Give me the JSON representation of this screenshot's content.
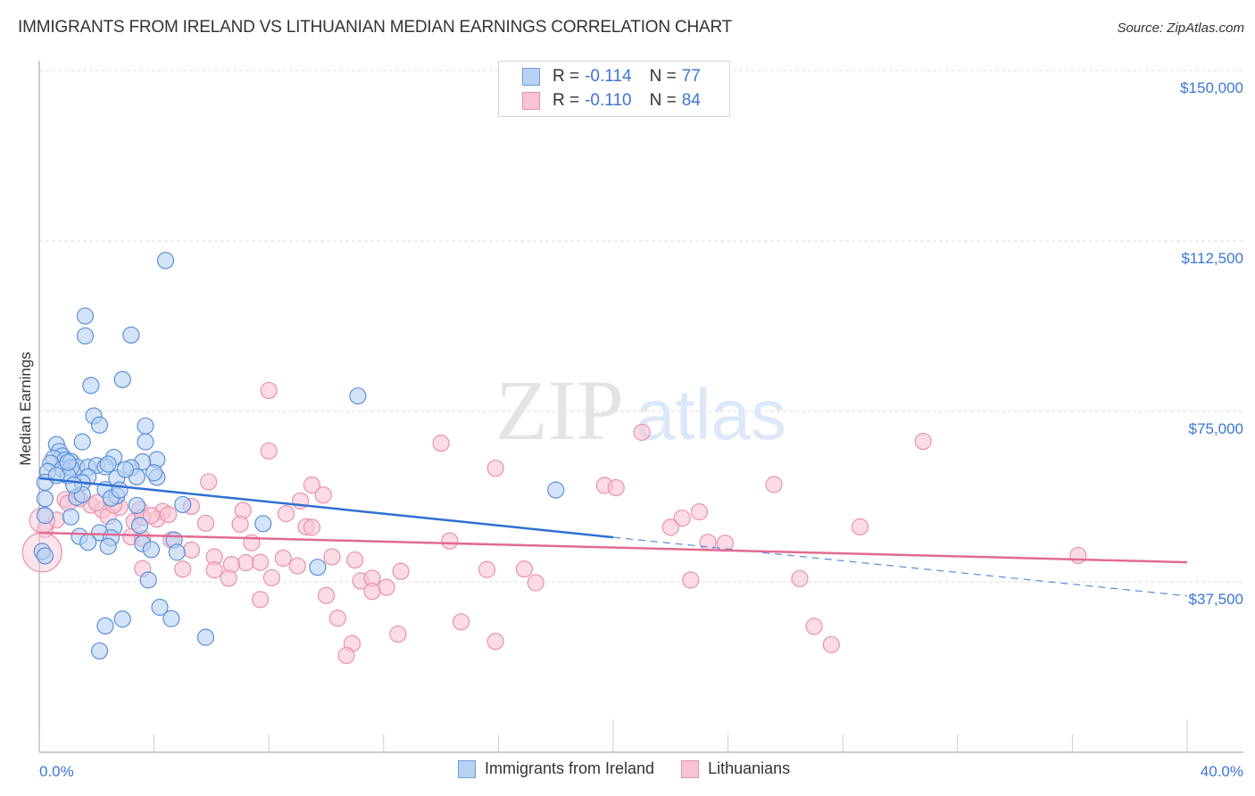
{
  "header": {
    "title": "IMMIGRANTS FROM IRELAND VS LITHUANIAN MEDIAN EARNINGS CORRELATION CHART",
    "source": "Source: ZipAtlas.com"
  },
  "watermark": {
    "zip": "ZIP",
    "atlas": "atlas"
  },
  "legend": {
    "rows": [
      {
        "r_label": "R =",
        "r_value": "-0.114",
        "n_label": "N =",
        "n_value": "77"
      },
      {
        "r_label": "R =",
        "r_value": "-0.110",
        "n_label": "N =",
        "n_value": "84"
      }
    ]
  },
  "bottom_legend": [
    "Immigrants from Ireland",
    "Lithuanians"
  ],
  "colors": {
    "blue_fill": "#b8d2f3",
    "blue_stroke": "#5b8fd8",
    "blue_line": "#2f6fd1",
    "pink_fill": "#f8c4d4",
    "pink_stroke": "#e891ac",
    "pink_line": "#e26a91",
    "tick_text": "#3a76d4"
  },
  "chart_data": {
    "type": "scatter",
    "title": "IMMIGRANTS FROM IRELAND VS LITHUANIAN MEDIAN EARNINGS CORRELATION CHART",
    "xlabel": "",
    "ylabel": "Median Earnings",
    "xlim": [
      0,
      40
    ],
    "ylim": [
      0,
      155000
    ],
    "x_tick_labels": [
      "0.0%",
      "40.0%"
    ],
    "y_ticks": [
      37500,
      75000,
      112500,
      150000
    ],
    "y_tick_labels": [
      "$37,500",
      "$75,000",
      "$112,500",
      "$150,000"
    ],
    "grid": true,
    "legend_position": "top-center",
    "series": [
      {
        "name": "Immigrants from Ireland",
        "R": -0.114,
        "N": 77,
        "trend": {
          "x": [
            0,
            20,
            40
          ],
          "y": [
            60300,
            47300,
            34400
          ],
          "solid_until": 20
        },
        "points": [
          [
            4.4,
            108200
          ],
          [
            1.6,
            96000
          ],
          [
            3.2,
            91800
          ],
          [
            1.6,
            91600
          ],
          [
            2.9,
            82000
          ],
          [
            1.8,
            80700
          ],
          [
            11.1,
            78400
          ],
          [
            1.9,
            74000
          ],
          [
            2.1,
            72000
          ],
          [
            3.7,
            71800
          ],
          [
            1.5,
            68300
          ],
          [
            3.7,
            68300
          ],
          [
            0.6,
            67700
          ],
          [
            0.7,
            66200
          ],
          [
            0.8,
            65200
          ],
          [
            0.5,
            64700
          ],
          [
            0.9,
            64300
          ],
          [
            1.1,
            64000
          ],
          [
            4.1,
            64400
          ],
          [
            3.6,
            63900
          ],
          [
            2.6,
            64900
          ],
          [
            0.4,
            63600
          ],
          [
            1.3,
            62800
          ],
          [
            1.7,
            62700
          ],
          [
            2.0,
            63100
          ],
          [
            0.8,
            62300
          ],
          [
            1.1,
            62600
          ],
          [
            2.3,
            62800
          ],
          [
            3.2,
            62600
          ],
          [
            0.3,
            61800
          ],
          [
            1.0,
            60800
          ],
          [
            1.7,
            60600
          ],
          [
            4.1,
            60500
          ],
          [
            3.4,
            60600
          ],
          [
            2.7,
            60300
          ],
          [
            0.2,
            59400
          ],
          [
            1.5,
            59300
          ],
          [
            2.3,
            57800
          ],
          [
            0.2,
            55800
          ],
          [
            1.3,
            56100
          ],
          [
            1.5,
            56700
          ],
          [
            2.7,
            56400
          ],
          [
            2.5,
            55900
          ],
          [
            3.4,
            54300
          ],
          [
            5.0,
            54500
          ],
          [
            0.2,
            52100
          ],
          [
            1.1,
            51800
          ],
          [
            18.0,
            57700
          ],
          [
            7.8,
            50300
          ],
          [
            2.6,
            49500
          ],
          [
            3.5,
            49900
          ],
          [
            2.1,
            48300
          ],
          [
            1.4,
            47500
          ],
          [
            2.5,
            47200
          ],
          [
            4.7,
            46700
          ],
          [
            1.7,
            46200
          ],
          [
            3.6,
            45900
          ],
          [
            2.4,
            45300
          ],
          [
            4.8,
            44000
          ],
          [
            3.9,
            44600
          ],
          [
            0.1,
            44200
          ],
          [
            9.7,
            40700
          ],
          [
            3.8,
            37900
          ],
          [
            4.2,
            31900
          ],
          [
            4.6,
            29400
          ],
          [
            2.9,
            29300
          ],
          [
            2.3,
            27800
          ],
          [
            5.8,
            25300
          ],
          [
            2.1,
            22300
          ],
          [
            0.2,
            43200
          ],
          [
            0.6,
            60900
          ],
          [
            1.0,
            63800
          ],
          [
            3.0,
            62200
          ],
          [
            2.8,
            57700
          ],
          [
            4.0,
            61500
          ],
          [
            1.2,
            58800
          ],
          [
            2.4,
            63400
          ]
        ]
      },
      {
        "name": "Lithuanians",
        "R": -0.11,
        "N": 84,
        "trend": {
          "x": [
            0,
            40
          ],
          "y": [
            48300,
            41800
          ]
        },
        "points": [
          [
            8.0,
            79600
          ],
          [
            21.0,
            70400
          ],
          [
            30.8,
            68400
          ],
          [
            14.0,
            68000
          ],
          [
            8.0,
            66300
          ],
          [
            15.9,
            62500
          ],
          [
            5.9,
            59500
          ],
          [
            9.5,
            58800
          ],
          [
            19.7,
            58700
          ],
          [
            20.1,
            58200
          ],
          [
            25.6,
            58900
          ],
          [
            9.9,
            56600
          ],
          [
            9.1,
            55300
          ],
          [
            5.3,
            54100
          ],
          [
            1.8,
            54400
          ],
          [
            2.2,
            53300
          ],
          [
            2.8,
            53900
          ],
          [
            3.5,
            53400
          ],
          [
            4.3,
            53000
          ],
          [
            7.1,
            53200
          ],
          [
            8.6,
            52500
          ],
          [
            0.6,
            51100
          ],
          [
            2.4,
            51900
          ],
          [
            3.3,
            50800
          ],
          [
            4.1,
            51300
          ],
          [
            5.8,
            50400
          ],
          [
            7.0,
            50200
          ],
          [
            22.4,
            51500
          ],
          [
            22.0,
            49500
          ],
          [
            23.0,
            52900
          ],
          [
            9.3,
            49600
          ],
          [
            9.5,
            49500
          ],
          [
            0.2,
            49000
          ],
          [
            0.9,
            55600
          ],
          [
            1.4,
            55800
          ],
          [
            2.0,
            54900
          ],
          [
            2.6,
            54400
          ],
          [
            3.6,
            51700
          ],
          [
            3.9,
            52100
          ],
          [
            4.5,
            52300
          ],
          [
            1.0,
            54800
          ],
          [
            3.2,
            47400
          ],
          [
            3.6,
            47000
          ],
          [
            4.6,
            46700
          ],
          [
            7.4,
            46100
          ],
          [
            14.3,
            46500
          ],
          [
            23.3,
            46200
          ],
          [
            23.9,
            46000
          ],
          [
            5.3,
            44500
          ],
          [
            8.5,
            42700
          ],
          [
            6.1,
            43000
          ],
          [
            7.2,
            41700
          ],
          [
            6.7,
            41300
          ],
          [
            7.7,
            41800
          ],
          [
            9.0,
            41000
          ],
          [
            10.2,
            43000
          ],
          [
            11.0,
            42300
          ],
          [
            5.0,
            40300
          ],
          [
            6.1,
            40100
          ],
          [
            3.6,
            40400
          ],
          [
            12.6,
            39800
          ],
          [
            15.6,
            40200
          ],
          [
            16.9,
            40300
          ],
          [
            17.3,
            37300
          ],
          [
            6.6,
            38300
          ],
          [
            8.1,
            38400
          ],
          [
            11.2,
            37700
          ],
          [
            11.6,
            38300
          ],
          [
            12.1,
            36300
          ],
          [
            11.6,
            35400
          ],
          [
            22.7,
            37900
          ],
          [
            26.5,
            38200
          ],
          [
            28.6,
            49600
          ],
          [
            10.0,
            34500
          ],
          [
            7.7,
            33600
          ],
          [
            10.4,
            29500
          ],
          [
            14.7,
            28700
          ],
          [
            15.9,
            24400
          ],
          [
            12.5,
            26000
          ],
          [
            10.9,
            23900
          ],
          [
            10.7,
            21300
          ],
          [
            27.6,
            23700
          ],
          [
            27.0,
            27700
          ],
          [
            36.2,
            43300
          ]
        ]
      }
    ]
  }
}
